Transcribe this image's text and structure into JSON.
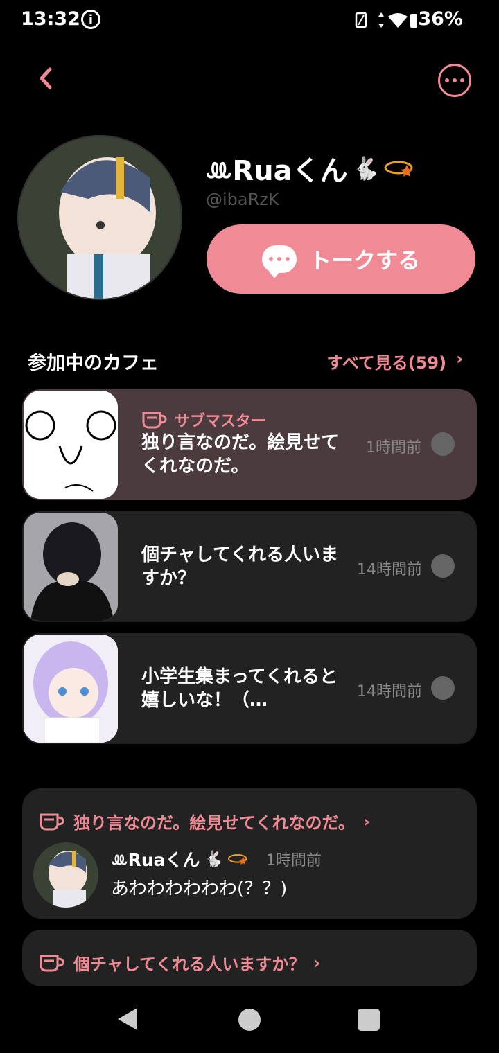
{
  "status_bar": {
    "time": "13:32",
    "battery": "36%"
  },
  "profile": {
    "name": "ꔛRuaくん",
    "name_emoji": "🐇",
    "handle": "@ibaRzK",
    "talk_button": "トークする"
  },
  "section": {
    "title": "参加中のカフェ",
    "see_all": "すべて見る(59)"
  },
  "cafes": [
    {
      "role": "サブマスター",
      "title": "独り言なのだ。絵見せてくれなのだ。",
      "time": "1時間前"
    },
    {
      "role": "",
      "title": "個チャしてくれる人いますか？",
      "time": "14時間前"
    },
    {
      "role": "",
      "title": "小学生集まってくれると嬉しいな！（…",
      "time": "14時間前"
    }
  ],
  "posts": [
    {
      "cafe": "独り言なのだ。絵見せてくれなのだ。",
      "author": "ꔛRuaくん",
      "author_emoji": "🐇",
      "time": "1時間前",
      "body": "あわわわわわわ(？？)"
    },
    {
      "cafe": "個チャしてくれる人いますか？"
    }
  ],
  "colors": {
    "accent": "#f08a95",
    "card": "#222222",
    "card_active": "#4b3a3e"
  },
  "icons": {
    "back": "chevron-left-icon",
    "more": "more-horizontal-icon",
    "talk": "chat-bubble-icon",
    "cafe": "coffee-cup-icon"
  }
}
